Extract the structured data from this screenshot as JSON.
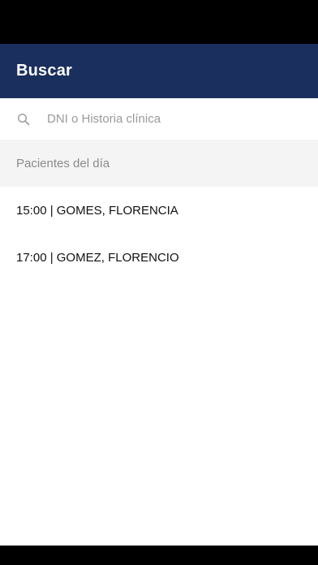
{
  "app_bar": {
    "title": "Buscar",
    "color": "#1b2f5e"
  },
  "search": {
    "icon": "search-icon",
    "placeholder": "DNI o Historia clínica",
    "value": ""
  },
  "section": {
    "title": "Pacientes del día"
  },
  "patients": [
    {
      "label": "15:00 | GOMES, FLORENCIA"
    },
    {
      "label": "17:00 | GOMEZ, FLORENCIO"
    }
  ]
}
